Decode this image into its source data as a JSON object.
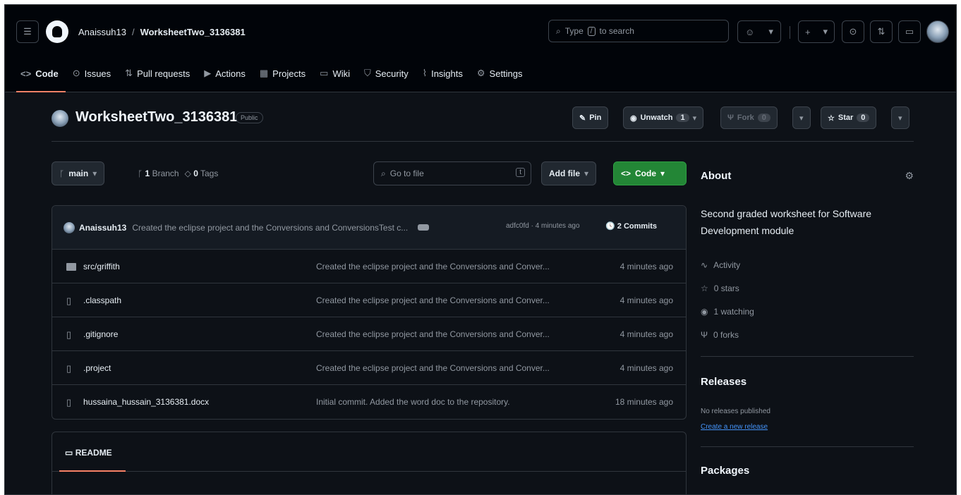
{
  "header": {
    "owner": "Anaissuh13",
    "separator": "/",
    "repo": "WorksheetTwo_3136381",
    "search_placeholder_pre": "Type",
    "search_key": "/",
    "search_placeholder_post": "to search"
  },
  "tabs": [
    {
      "icon": "<>",
      "label": "Code"
    },
    {
      "icon": "⊙",
      "label": "Issues"
    },
    {
      "icon": "⇅",
      "label": "Pull requests"
    },
    {
      "icon": "▶",
      "label": "Actions"
    },
    {
      "icon": "▦",
      "label": "Projects"
    },
    {
      "icon": "▭",
      "label": "Wiki"
    },
    {
      "icon": "⛉",
      "label": "Security"
    },
    {
      "icon": "⌇",
      "label": "Insights"
    },
    {
      "icon": "⚙",
      "label": "Settings"
    }
  ],
  "repo_header": {
    "name": "WorksheetTwo_3136381",
    "visibility": "Public",
    "pin": "Pin",
    "unwatch": "Unwatch",
    "watch_count": "1",
    "fork": "Fork",
    "fork_count": "0",
    "star": "Star",
    "star_count": "0"
  },
  "toolbar": {
    "branch": "main",
    "branches_count": "1",
    "branches_label": "Branch",
    "tags_count": "0",
    "tags_label": "Tags",
    "go_to_file": "Go to file",
    "go_to_file_key": "t",
    "add_file": "Add file",
    "code": "Code"
  },
  "latest_commit": {
    "author": "Anaissuh13",
    "message": "Created the eclipse project and the Conversions and ConversionsTest c...",
    "hash_time": "adfc0fd · 4 minutes ago",
    "commits": "2 Commits"
  },
  "files": [
    {
      "type": "folder",
      "name": "src/griffith",
      "message": "Created the eclipse project and the Conversions and Conver...",
      "time": "4 minutes ago"
    },
    {
      "type": "file",
      "name": ".classpath",
      "message": "Created the eclipse project and the Conversions and Conver...",
      "time": "4 minutes ago"
    },
    {
      "type": "file",
      "name": ".gitignore",
      "message": "Created the eclipse project and the Conversions and Conver...",
      "time": "4 minutes ago"
    },
    {
      "type": "file",
      "name": ".project",
      "message": "Created the eclipse project and the Conversions and Conver...",
      "time": "4 minutes ago"
    },
    {
      "type": "file",
      "name": "hussaina_hussain_3136381.docx",
      "message": "Initial commit. Added the word doc to the repository.",
      "time": "18 minutes ago"
    }
  ],
  "readme": {
    "title": "README"
  },
  "about": {
    "title": "About",
    "description": "Second graded worksheet for Software Development module",
    "activity": "Activity",
    "stars": "0 stars",
    "watching": "1 watching",
    "forks": "0 forks"
  },
  "releases": {
    "title": "Releases",
    "none": "No releases published",
    "create": "Create a new release"
  },
  "packages": {
    "title": "Packages"
  }
}
